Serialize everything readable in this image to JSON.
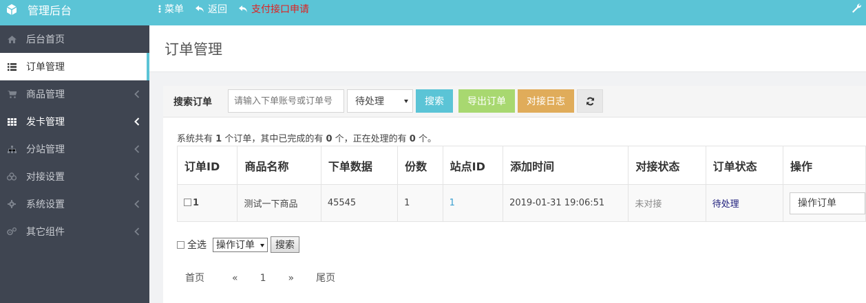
{
  "app": {
    "title": "管理后台"
  },
  "topnav": {
    "menu": "菜单",
    "back": "返回",
    "payment": "支付接口申请"
  },
  "sidebar": {
    "items": [
      {
        "label": "后台首页",
        "icon": "home-icon"
      },
      {
        "label": "订单管理",
        "icon": "list-icon"
      },
      {
        "label": "商品管理",
        "icon": "cart-icon"
      },
      {
        "label": "发卡管理",
        "icon": "grid-icon"
      },
      {
        "label": "分站管理",
        "icon": "sitemap-icon"
      },
      {
        "label": "对接设置",
        "icon": "cubes-icon"
      },
      {
        "label": "系统设置",
        "icon": "gear-icon"
      },
      {
        "label": "其它组件",
        "icon": "cogs-icon"
      }
    ]
  },
  "page": {
    "title": "订单管理"
  },
  "search": {
    "label": "搜索订单",
    "placeholder": "请输入下单账号或订单号",
    "status_value": "待处理",
    "search_button": "搜索",
    "export_button": "导出订单",
    "log_button": "对接日志"
  },
  "summary": {
    "prefix": "系统共有 ",
    "total": "1",
    "mid1": " 个订单，其中已完成的有 ",
    "completed": "0",
    "mid2": " 个，正在处理的有 ",
    "processing": "0",
    "suffix": " 个。"
  },
  "table": {
    "headers": [
      "订单ID",
      "商品名称",
      "下单数据",
      "份数",
      "站点ID",
      "添加时间",
      "对接状态",
      "订单状态",
      "操作"
    ],
    "rows": [
      {
        "id": "1",
        "product": "测试一下商品",
        "data": "45545",
        "qty": "1",
        "site_id": "1",
        "time": "2019-01-31 19:06:51",
        "dock_status": "未对接",
        "order_status": "待处理",
        "action": "操作订单"
      }
    ]
  },
  "bulk": {
    "select_all": "全选",
    "action_value": "操作订单",
    "submit": "搜索"
  },
  "pager": {
    "first": "首页",
    "prev": "«",
    "current": "1",
    "next": "»",
    "last": "尾页"
  },
  "colors": {
    "accent": "#5bc4d6",
    "sidebar": "#3f4551",
    "export": "#a8d870",
    "log": "#e0ac5a",
    "alert": "#e02020"
  }
}
